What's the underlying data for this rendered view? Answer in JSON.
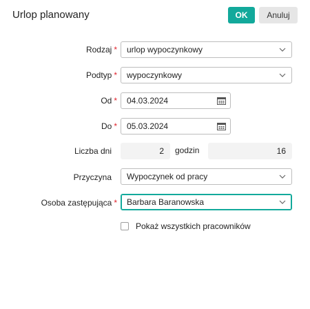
{
  "dialog": {
    "title": "Urlop planowany",
    "ok_label": "OK",
    "cancel_label": "Anuluj"
  },
  "form": {
    "rodzaj": {
      "label": "Rodzaj",
      "value": "urlop wypoczynkowy",
      "required": true
    },
    "podtyp": {
      "label": "Podtyp",
      "value": "wypoczynkowy",
      "required": true
    },
    "od": {
      "label": "Od",
      "value": "04.03.2024",
      "required": true
    },
    "do": {
      "label": "Do",
      "value": "05.03.2024",
      "required": true
    },
    "liczba_dni": {
      "label": "Liczba dni",
      "value": "2"
    },
    "godzin": {
      "label": "godzin",
      "value": "16"
    },
    "przyczyna": {
      "label": "Przyczyna",
      "value": "Wypoczynek od pracy"
    },
    "osoba": {
      "label": "Osoba zastępująca",
      "value": "Barbara Baranowska",
      "required": true
    },
    "show_all": {
      "label": "Pokaż wszystkich pracowników",
      "checked": false
    }
  },
  "required_marker": "*",
  "colors": {
    "accent": "#12a99b",
    "required": "#e0242e"
  },
  "icons": {
    "dropdown": "chevron-down-icon",
    "date": "calendar-icon"
  }
}
